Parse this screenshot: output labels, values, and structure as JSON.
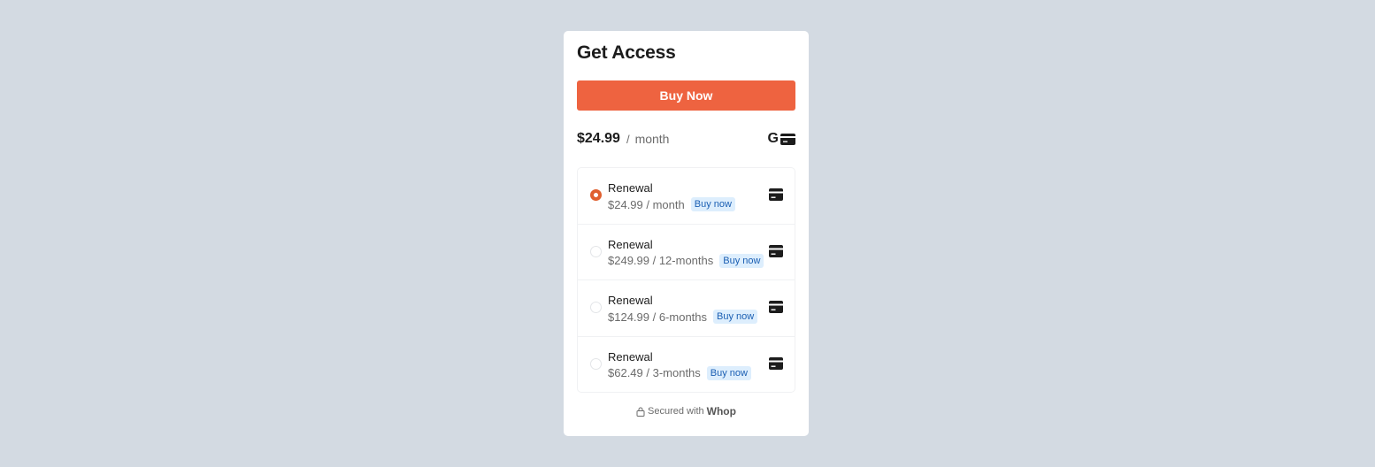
{
  "card": {
    "title": "Get Access",
    "buy_button_label": "Buy Now"
  },
  "price": {
    "amount": "$24.99",
    "separator": "/",
    "period": "month",
    "payment_icons": [
      "google-pay-icon",
      "credit-card-icon"
    ]
  },
  "plans": [
    {
      "name": "Renewal",
      "price": "$24.99 / month",
      "badge": "Buy now",
      "selected": true,
      "icon": "credit-card-icon"
    },
    {
      "name": "Renewal",
      "price": "$249.99 / 12-months",
      "badge": "Buy now",
      "selected": false,
      "icon": "credit-card-icon"
    },
    {
      "name": "Renewal",
      "price": "$124.99 / 6-months",
      "badge": "Buy now",
      "selected": false,
      "icon": "credit-card-icon"
    },
    {
      "name": "Renewal",
      "price": "$62.49 / 3-months",
      "badge": "Buy now",
      "selected": false,
      "icon": "credit-card-icon"
    }
  ],
  "footer": {
    "text": "Secured with",
    "brand": "Whop",
    "icon": "lock-icon"
  },
  "colors": {
    "background": "#d3dae2",
    "accent": "#ee6340",
    "badge_bg": "#ddeefd",
    "badge_text": "#1b5fb3"
  }
}
